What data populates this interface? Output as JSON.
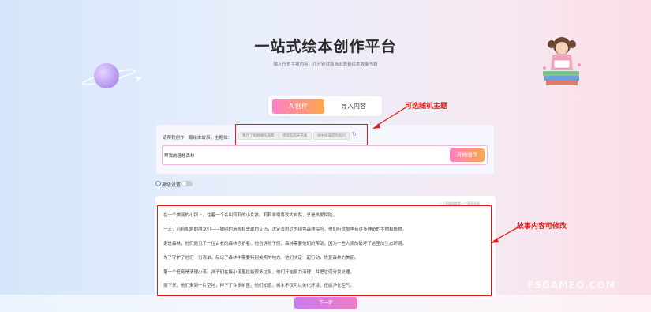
{
  "hero": {
    "title": "一站式绘本创作平台",
    "subtitle": "输入任意主题内容，几分钟就能画出质量绘本故事书籍"
  },
  "tabs": [
    {
      "label": "AI创作",
      "active": true
    },
    {
      "label": "导入内容",
      "active": false
    }
  ],
  "prompt": {
    "label": "请帮我创作一篇绘本故事，主题如：",
    "chips": [
      "我为了照顾哪吒哥哥",
      "雪莲花的天花板",
      "地中海海岸的船只"
    ],
    "input_value": "帮我的理想森林",
    "start_label": "开始创作"
  },
  "advanced": {
    "label": "高级设置"
  },
  "story": {
    "hint": "一上键编辑查看一个图表选展",
    "lines": [
      "在一个美丽的小镇上，住着一个名叫莉莉的小女孩。莉莉非常喜欢大自然，总是热爱探险。",
      "一天，莉莉和她的朋友们——聪明的汤姆和勇敢的艾玛，决定去附近的绿色森林探险。他们听说那里有许多神奇的生物和植物。",
      "走进森林，他们遇见了一位古老的森林守护者。他告诉孩子们，森林需要他们的帮助，因为一些人类的破坏了这里的生态环境。",
      "为了守护了他们一份清单，标记了森林中需要特别关照的地方。他们决定一起行动，恢复森林的美丽。",
      "第一个任务是清理小溪。孩子们在接小溪里捡拾很多垃圾，他们开始努力清理，并把它们分类处理。",
      "接下来，他们来到一片空地，种下了许多树苗。他们知道，树木不仅可以美化环境，还能净化空气。"
    ]
  },
  "next_label": "下一步",
  "annotations": {
    "random_theme": "可选随机主题",
    "editable_story": "故事内容可修改"
  },
  "watermark": "FSGAMEO.COM",
  "colors": {
    "accent_gradient_start": "#ff7fc6",
    "accent_gradient_end": "#ffa64d",
    "annotation_red": "#e21c1c"
  }
}
